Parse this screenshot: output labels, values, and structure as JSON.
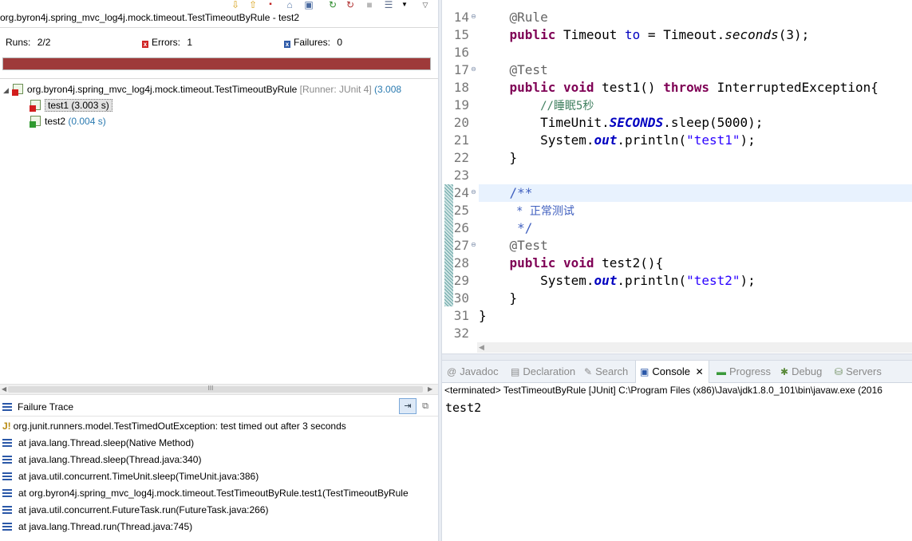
{
  "junit": {
    "title": "org.byron4j.spring_mvc_log4j.mock.timeout.TestTimeoutByRule - test2",
    "runs_label": "Runs:",
    "runs_value": "2/2",
    "errors_label": "Errors:",
    "errors_value": "1",
    "failures_label": "Failures:",
    "failures_value": "0",
    "progress_color": "#9e3a3a",
    "progress_fraction": 1.0,
    "tree": {
      "root_label": "org.byron4j.spring_mvc_log4j.mock.timeout.TestTimeoutByRule",
      "root_runner": "[Runner: JUnit 4]",
      "root_time": "(3.008",
      "tests": [
        {
          "name": "test1",
          "time": "(3.003 s)",
          "status": "error"
        },
        {
          "name": "test2",
          "time": "(0.004 s)",
          "status": "passed"
        }
      ]
    },
    "failure_trace": {
      "title": "Failure Trace",
      "lines": [
        "org.junit.runners.model.TestTimedOutException: test timed out after 3 seconds",
        "at java.lang.Thread.sleep(Native Method)",
        "at java.lang.Thread.sleep(Thread.java:340)",
        "at java.util.concurrent.TimeUnit.sleep(TimeUnit.java:386)",
        "at org.byron4j.spring_mvc_log4j.mock.timeout.TestTimeoutByRule.test1(TestTimeoutByRule",
        "at java.util.concurrent.FutureTask.run(FutureTask.java:266)",
        "at java.lang.Thread.run(Thread.java:745)"
      ]
    },
    "scroll_grip": "III"
  },
  "editor": {
    "line_numbers": [
      "14",
      "15",
      "16",
      "17",
      "18",
      "19",
      "20",
      "21",
      "22",
      "23",
      "24",
      "25",
      "26",
      "27",
      "28",
      "29",
      "30",
      "31",
      "32"
    ],
    "code": {
      "l14_ann": "@Rule",
      "l15_kw": "public",
      "l15_type": " Timeout ",
      "l15_field": "to",
      "l15_rest1": " = Timeout.",
      "l15_method": "seconds",
      "l15_rest2": "(3);",
      "l17_ann": "@Test",
      "l18_kw1": "public",
      "l18_kw2": "void",
      "l18_mid": " test1() ",
      "l18_kw3": "throws",
      "l18_rest": " InterruptedException{",
      "l19_comment": "//睡眠5秒",
      "l20_a": "TimeUnit.",
      "l20_field": "SECONDS",
      "l20_b": ".sleep(5000);",
      "l21_a": "System.",
      "l21_field": "out",
      "l21_b": ".println(",
      "l21_str": "\"test1\"",
      "l21_c": ");",
      "l22": "}",
      "l24": "/**",
      "l25": " * 正常测试",
      "l26": " */",
      "l27_ann": "@Test",
      "l28_kw1": "public",
      "l28_kw2": "void",
      "l28_rest": " test2(){",
      "l29_a": "System.",
      "l29_field": "out",
      "l29_b": ".println(",
      "l29_str": "\"test2\"",
      "l29_c": ");",
      "l30": "}",
      "l31": "}"
    }
  },
  "bottom_tabs": {
    "javadoc": "Javadoc",
    "declaration": "Declaration",
    "search": "Search",
    "console": "Console",
    "progress": "Progress",
    "debug": "Debug",
    "servers": "Servers"
  },
  "console": {
    "status": "<terminated> TestTimeoutByRule [JUnit] C:\\Program Files (x86)\\Java\\jdk1.8.0_101\\bin\\javaw.exe (2016",
    "output": "test2"
  }
}
